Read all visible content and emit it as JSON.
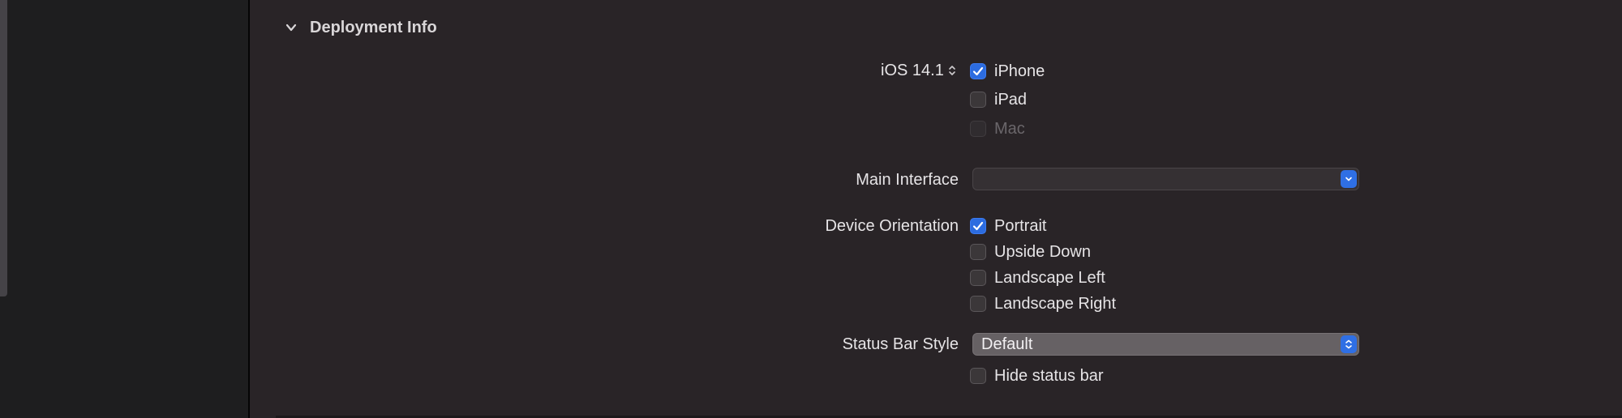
{
  "section": {
    "title": "Deployment Info"
  },
  "deployment_target": {
    "value": "iOS 14.1"
  },
  "devices": [
    {
      "label": "iPhone",
      "checked": true,
      "enabled": true
    },
    {
      "label": "iPad",
      "checked": false,
      "enabled": true
    },
    {
      "label": "Mac",
      "checked": false,
      "enabled": false
    }
  ],
  "main_interface": {
    "label": "Main Interface",
    "value": ""
  },
  "device_orientation": {
    "label": "Device Orientation",
    "options": [
      {
        "label": "Portrait",
        "checked": true
      },
      {
        "label": "Upside Down",
        "checked": false
      },
      {
        "label": "Landscape Left",
        "checked": false
      },
      {
        "label": "Landscape Right",
        "checked": false
      }
    ]
  },
  "status_bar_style": {
    "label": "Status Bar Style",
    "value": "Default"
  },
  "hide_status_bar": {
    "label": "Hide status bar",
    "checked": false
  },
  "colors": {
    "accent": "#2c6ce0",
    "background": "#292427",
    "sidebar": "#1e1e1f"
  }
}
